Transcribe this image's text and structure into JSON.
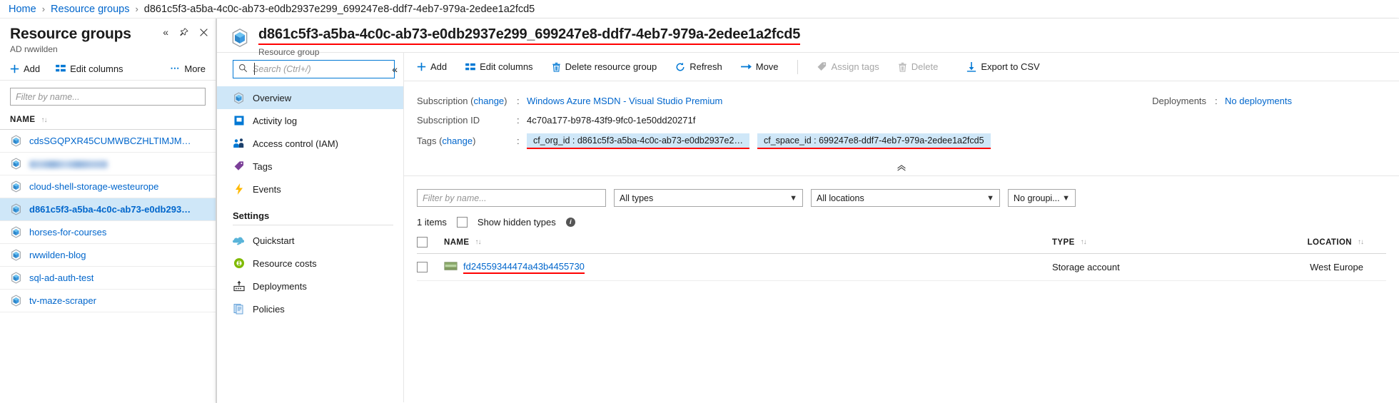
{
  "breadcrumb": {
    "home": "Home",
    "resource_groups": "Resource groups",
    "current": "d861c5f3-a5ba-4c0c-ab73-e0db2937e299_699247e8-ddf7-4eb7-979a-2edee1a2fcd5",
    "separator": "›"
  },
  "resource_groups_blade": {
    "title": "Resource groups",
    "subtitle": "AD rwwilden",
    "toolbar": {
      "add": "Add",
      "edit_columns": "Edit columns",
      "more": "More"
    },
    "filter_placeholder": "Filter by name...",
    "column_name": "NAME",
    "items": [
      {
        "name": "cdsSGQPXR45CUMWBCZHLTIMJM…",
        "selected": false,
        "blurred": false
      },
      {
        "name": "",
        "selected": false,
        "blurred": true
      },
      {
        "name": "cloud-shell-storage-westeurope",
        "selected": false,
        "blurred": false
      },
      {
        "name": "d861c5f3-a5ba-4c0c-ab73-e0db293…",
        "selected": true,
        "blurred": false
      },
      {
        "name": "horses-for-courses",
        "selected": false,
        "blurred": false
      },
      {
        "name": "rwwilden-blog",
        "selected": false,
        "blurred": false
      },
      {
        "name": "sql-ad-auth-test",
        "selected": false,
        "blurred": false
      },
      {
        "name": "tv-maze-scraper",
        "selected": false,
        "blurred": false
      }
    ]
  },
  "resource_blade": {
    "title": "d861c5f3-a5ba-4c0c-ab73-e0db2937e299_699247e8-ddf7-4eb7-979a-2edee1a2fcd5",
    "subtitle": "Resource group",
    "search_placeholder": "Search (Ctrl+/)",
    "nav": {
      "items": [
        {
          "label": "Overview",
          "icon": "cube-icon",
          "active": true
        },
        {
          "label": "Activity log",
          "icon": "activity-log-icon",
          "active": false
        },
        {
          "label": "Access control (IAM)",
          "icon": "access-control-icon",
          "active": false
        },
        {
          "label": "Tags",
          "icon": "tag-icon",
          "active": false
        },
        {
          "label": "Events",
          "icon": "events-icon",
          "active": false
        }
      ],
      "section_label": "Settings",
      "settings_items": [
        {
          "label": "Quickstart",
          "icon": "quickstart-icon",
          "active": false
        },
        {
          "label": "Resource costs",
          "icon": "resource-costs-icon",
          "active": false
        },
        {
          "label": "Deployments",
          "icon": "deployments-icon",
          "active": false
        },
        {
          "label": "Policies",
          "icon": "policies-icon",
          "active": false
        }
      ]
    },
    "toolbar": [
      {
        "label": "Add",
        "icon": "plus-icon",
        "disabled": false
      },
      {
        "label": "Edit columns",
        "icon": "columns-icon",
        "disabled": false
      },
      {
        "label": "Delete resource group",
        "icon": "trash-icon",
        "disabled": false
      },
      {
        "label": "Refresh",
        "icon": "refresh-icon",
        "disabled": false
      },
      {
        "label": "Move",
        "icon": "move-arrow-icon",
        "disabled": false
      },
      {
        "label": "Assign tags",
        "icon": "tag-icon",
        "disabled": true
      },
      {
        "label": "Delete",
        "icon": "trash-icon",
        "disabled": true
      },
      {
        "label": "Export to CSV",
        "icon": "download-icon",
        "disabled": false
      }
    ],
    "essentials": {
      "subscription_label": "Subscription",
      "subscription_change": "change",
      "subscription_value": "Windows Azure MSDN - Visual Studio Premium",
      "subscription_id_label": "Subscription ID",
      "subscription_id_value": "4c70a177-b978-43f9-9fc0-1e50dd20271f",
      "tags_label": "Tags",
      "tags_change": "change",
      "tags": [
        "cf_org_id : d861c5f3-a5ba-4c0c-ab73-e0db2937e2…",
        "cf_space_id : 699247e8-ddf7-4eb7-979a-2edee1a2fcd5"
      ],
      "deployments_label": "Deployments",
      "deployments_value": "No deployments",
      "colon": ":"
    },
    "resource_list": {
      "filter_placeholder": "Filter by name...",
      "type_filter": "All types",
      "location_filter": "All locations",
      "grouping_filter": "No groupi...",
      "items_count": "1 items",
      "show_hidden_label": "Show hidden types",
      "columns": {
        "name": "NAME",
        "type": "TYPE",
        "location": "LOCATION"
      },
      "rows": [
        {
          "name": "fd24559344474a43b4455730",
          "type": "Storage account",
          "location": "West Europe",
          "icon": "storage-account-icon"
        }
      ]
    }
  },
  "colors": {
    "accent": "#0078d4",
    "link": "#0066cc",
    "selection": "#cfe7f8",
    "highlight_underline": "#ff0000"
  }
}
